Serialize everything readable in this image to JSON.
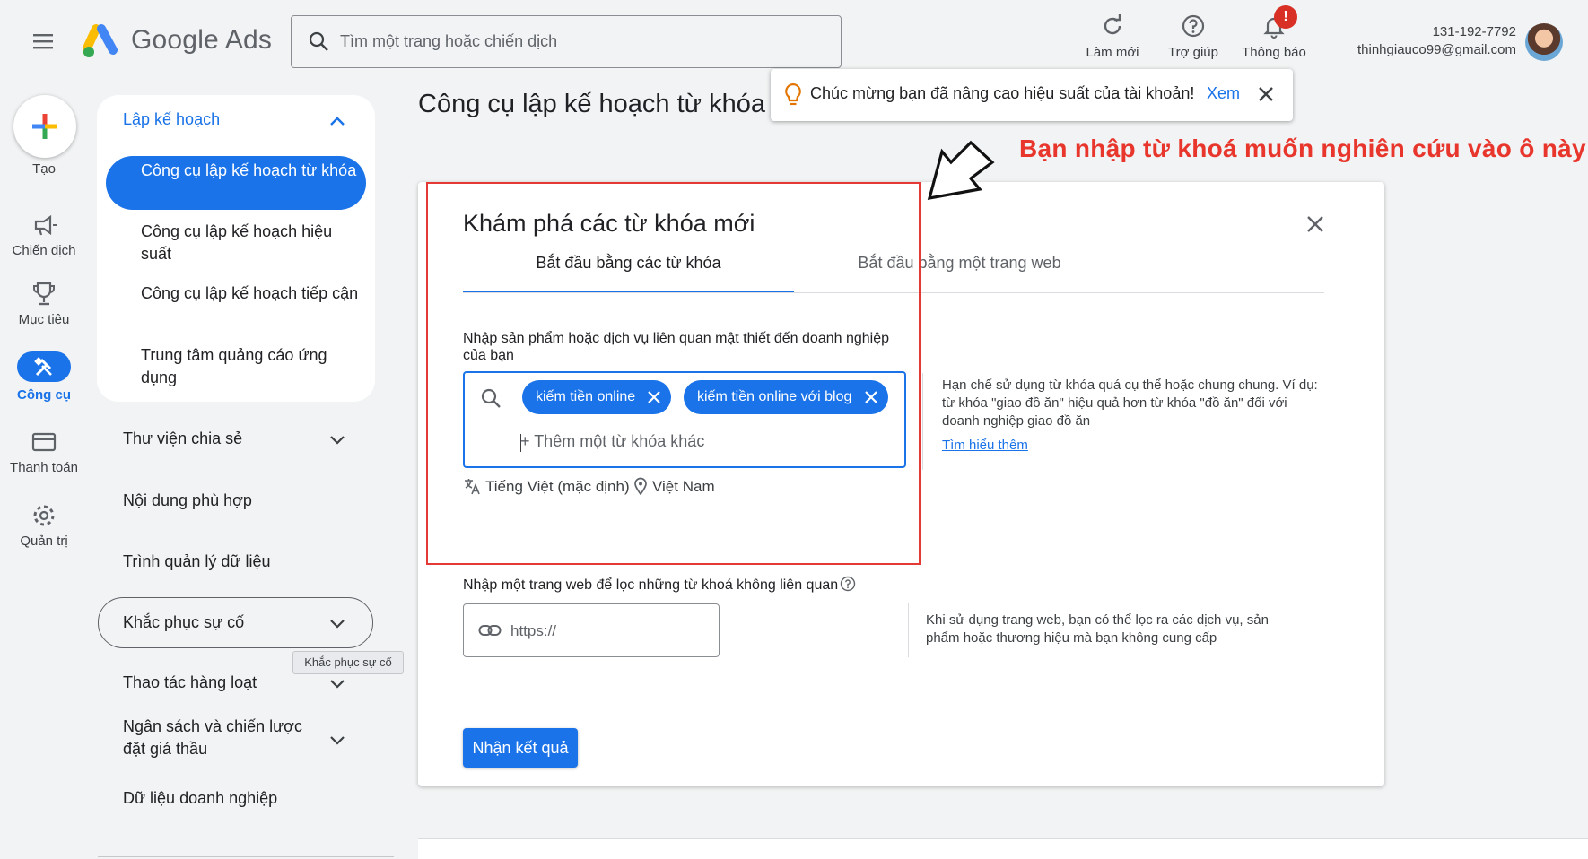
{
  "header": {
    "brand": "Google Ads",
    "search_placeholder": "Tìm một trang hoặc chiến dịch",
    "actions": [
      {
        "label": "Làm mới",
        "icon": "refresh-icon"
      },
      {
        "label": "Trợ giúp",
        "icon": "help-icon"
      },
      {
        "label": "Thông báo",
        "icon": "bell-icon",
        "badge": "!"
      }
    ],
    "account_id": "131-192-7792",
    "account_email": "thinhgiauco99@gmail.com"
  },
  "rail": {
    "create": "Tạo",
    "items": [
      {
        "label": "Chiến dịch",
        "icon": "megaphone-icon"
      },
      {
        "label": "Mục tiêu",
        "icon": "trophy-icon"
      },
      {
        "label": "Công cụ",
        "icon": "tools-icon",
        "active": true
      },
      {
        "label": "Thanh toán",
        "icon": "credit-card-icon"
      },
      {
        "label": "Quản trị",
        "icon": "settings-icon"
      }
    ]
  },
  "nav": {
    "expanded_section": "Lập kế hoạch",
    "sub_items": [
      "Công cụ lập kế hoạch từ khóa",
      "Công cụ lập kế hoạch hiệu suất",
      "Công cụ lập kế hoạch tiếp cận",
      "Trung tâm quảng cáo ứng dụng"
    ],
    "sections": [
      "Thư viện chia sẻ",
      "Nội dung phù hợp",
      "Trình quản lý dữ liệu",
      "Khắc phục sự cố",
      "Thao tác hàng loạt",
      "Ngân sách và chiến lược đặt giá thầu",
      "Dữ liệu doanh nghiệp"
    ],
    "tooltip": "Khắc phục sự cố"
  },
  "page": {
    "title": "Công cụ lập kế hoạch từ khóa"
  },
  "toast": {
    "message": "Chúc mừng bạn đã nâng cao hiệu suất của tài khoản!",
    "link": "Xem"
  },
  "annotation": {
    "text": "Bạn nhập từ khoá muốn nghiên cứu vào ô này",
    "color": "#e8362c"
  },
  "card": {
    "title": "Khám phá các từ khóa mới",
    "tabs": [
      "Bắt đầu bằng các từ khóa",
      "Bắt đầu bằng một trang web"
    ],
    "keyword_label": "Nhập sản phẩm hoặc dịch vụ liên quan mật thiết đến doanh nghiệp của bạn",
    "chips": [
      "kiếm tiền online",
      "kiếm tiền online với blog"
    ],
    "keyword_placeholder": "Thêm một từ khóa khác",
    "language": "Tiếng Việt (mặc định)",
    "location": "Việt Nam",
    "hint": "Hạn chế sử dụng từ khóa quá cụ thể hoặc chung chung. Ví dụ: từ khóa \"giao đồ ăn\" hiệu quả hơn từ khóa \"đồ ăn\" đối với doanh nghiệp giao đồ ăn",
    "hint_link": "Tìm hiểu thêm",
    "url_label": "Nhập một trang web để lọc những từ khoá không liên quan",
    "url_placeholder": "https://",
    "url_hint": "Khi sử dụng trang web, bạn có thể lọc ra các dịch vụ, sản phẩm hoặc thương hiệu mà bạn không cung cấp",
    "submit": "Nhận kết quả"
  },
  "colors": {
    "accent": "#1a73e8",
    "background": "#f1f3f4",
    "badge": "#d93025"
  }
}
